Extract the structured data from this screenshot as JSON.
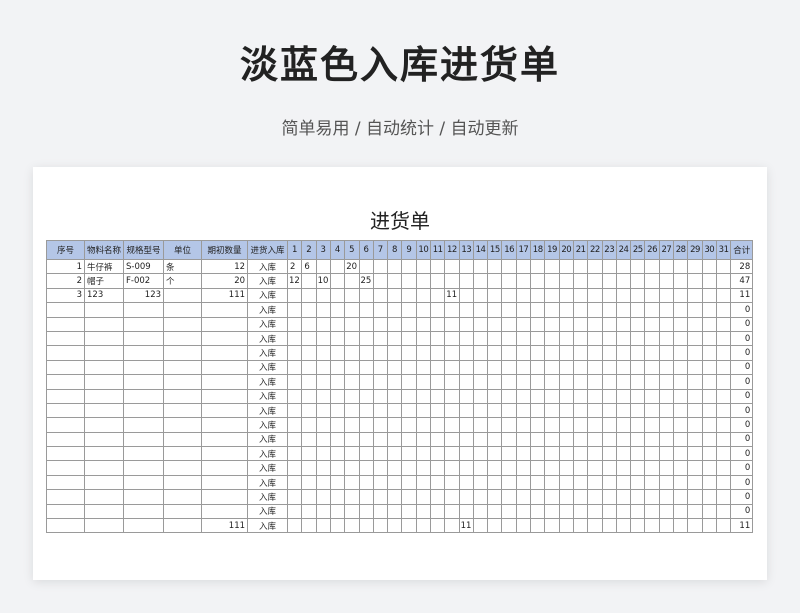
{
  "page": {
    "title": "淡蓝色入库进货单",
    "subtitle": "简单易用 / 自动统计 / 自动更新"
  },
  "sheet": {
    "title": "进货单",
    "headers": [
      "序号",
      "物料名称",
      "规格型号",
      "单位",
      "期初数量",
      "进货入库",
      "1",
      "2",
      "3",
      "4",
      "5",
      "6",
      "7",
      "8",
      "9",
      "10",
      "11",
      "12",
      "13",
      "14",
      "15",
      "16",
      "17",
      "18",
      "19",
      "20",
      "21",
      "22",
      "23",
      "24",
      "25",
      "26",
      "27",
      "28",
      "29",
      "30",
      "31",
      "合计"
    ],
    "rows": [
      {
        "no": "1",
        "name": "牛仔裤",
        "spec": "S-009",
        "unit": "条",
        "initial": "12",
        "type": "入库",
        "days": {
          "1": "2",
          "2": "6",
          "5": "20"
        },
        "total": "28"
      },
      {
        "no": "2",
        "name": "帽子",
        "spec": "F-002",
        "unit": "个",
        "initial": "20",
        "type": "入库",
        "days": {
          "1": "12",
          "3": "10",
          "6": "25"
        },
        "total": "47"
      },
      {
        "no": "3",
        "name": "123",
        "spec": "123",
        "unit": "",
        "initial": "111",
        "type": "入库",
        "days": {
          "12": "11"
        },
        "total": "11"
      },
      {
        "no": "",
        "name": "",
        "spec": "",
        "unit": "",
        "initial": "",
        "type": "入库",
        "days": {},
        "total": "0"
      },
      {
        "no": "",
        "name": "",
        "spec": "",
        "unit": "",
        "initial": "",
        "type": "入库",
        "days": {},
        "total": "0"
      },
      {
        "no": "",
        "name": "",
        "spec": "",
        "unit": "",
        "initial": "",
        "type": "入库",
        "days": {},
        "total": "0"
      },
      {
        "no": "",
        "name": "",
        "spec": "",
        "unit": "",
        "initial": "",
        "type": "入库",
        "days": {},
        "total": "0"
      },
      {
        "no": "",
        "name": "",
        "spec": "",
        "unit": "",
        "initial": "",
        "type": "入库",
        "days": {},
        "total": "0"
      },
      {
        "no": "",
        "name": "",
        "spec": "",
        "unit": "",
        "initial": "",
        "type": "入库",
        "days": {},
        "total": "0"
      },
      {
        "no": "",
        "name": "",
        "spec": "",
        "unit": "",
        "initial": "",
        "type": "入库",
        "days": {},
        "total": "0"
      },
      {
        "no": "",
        "name": "",
        "spec": "",
        "unit": "",
        "initial": "",
        "type": "入库",
        "days": {},
        "total": "0"
      },
      {
        "no": "",
        "name": "",
        "spec": "",
        "unit": "",
        "initial": "",
        "type": "入库",
        "days": {},
        "total": "0"
      },
      {
        "no": "",
        "name": "",
        "spec": "",
        "unit": "",
        "initial": "",
        "type": "入库",
        "days": {},
        "total": "0"
      },
      {
        "no": "",
        "name": "",
        "spec": "",
        "unit": "",
        "initial": "",
        "type": "入库",
        "days": {},
        "total": "0"
      },
      {
        "no": "",
        "name": "",
        "spec": "",
        "unit": "",
        "initial": "",
        "type": "入库",
        "days": {},
        "total": "0"
      },
      {
        "no": "",
        "name": "",
        "spec": "",
        "unit": "",
        "initial": "",
        "type": "入库",
        "days": {},
        "total": "0"
      },
      {
        "no": "",
        "name": "",
        "spec": "",
        "unit": "",
        "initial": "",
        "type": "入库",
        "days": {},
        "total": "0"
      },
      {
        "no": "",
        "name": "",
        "spec": "",
        "unit": "",
        "initial": "",
        "type": "入库",
        "days": {},
        "total": "0"
      },
      {
        "no": "",
        "name": "",
        "spec": "",
        "unit": "",
        "initial": "111",
        "type": "入库",
        "days": {
          "13": "11"
        },
        "total": "11"
      }
    ]
  },
  "colors": {
    "header_bg": "#b4c6e7",
    "grid_line": "#9a9a9a",
    "page_bg": "#f2f3f5"
  }
}
